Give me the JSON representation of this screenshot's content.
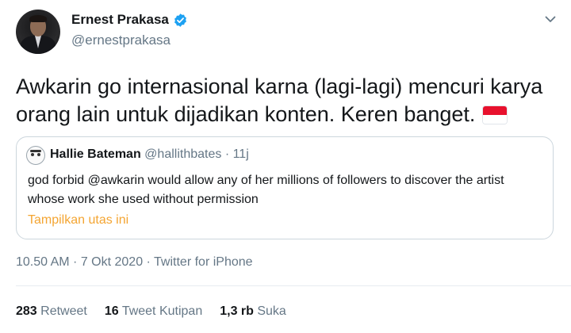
{
  "author": {
    "display_name": "Ernest Prakasa",
    "handle": "@ernestprakasa",
    "verified": true
  },
  "tweet": {
    "text": "Awkarin go internasional karna (lagi-lagi) mencuri karya orang lain untuk dijadikan konten. Keren banget.",
    "emoji": "indonesia-flag"
  },
  "quoted": {
    "display_name": "Hallie Bateman",
    "handle": "@hallithbates",
    "separator": "·",
    "time": "11j",
    "text": "god forbid @awkarin would allow any of her millions of followers to discover the artist whose work she used without permission",
    "thread_link": "Tampilkan utas ini"
  },
  "meta": {
    "timestamp": "10.50 AM · 7 Okt 2020 · ",
    "source": "Twitter for iPhone"
  },
  "stats": {
    "retweets_count": "283",
    "retweets_label": "Retweet",
    "quotes_count": "16",
    "quotes_label": "Tweet Kutipan",
    "likes_count": "1,3 rb",
    "likes_label": "Suka"
  },
  "colors": {
    "verified_blue": "#1da1f2",
    "secondary_text": "#657786",
    "thread_link": "#f4a532",
    "border": "#ccd6dd"
  }
}
